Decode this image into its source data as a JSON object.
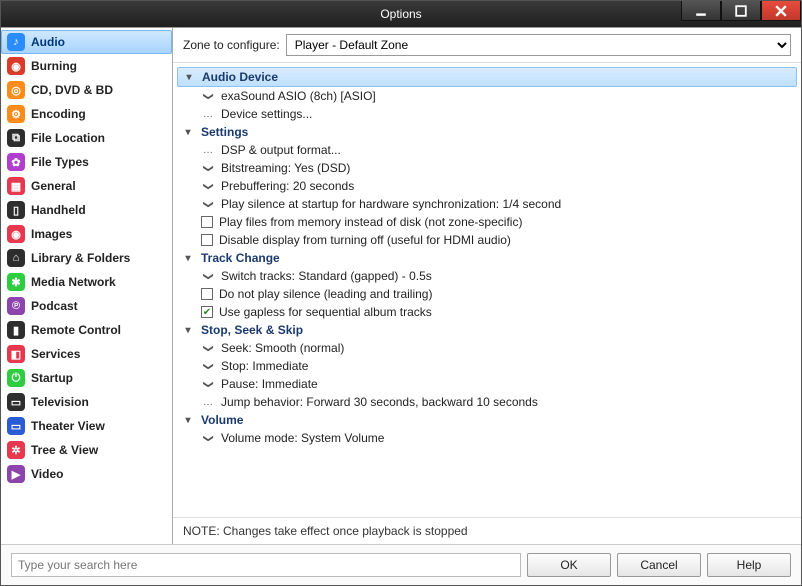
{
  "window": {
    "title": "Options"
  },
  "sidebar": {
    "items": [
      {
        "label": "Audio",
        "icon_bg": "#2a8cff",
        "glyph": "♪",
        "selected": true,
        "icon_name": "audio-icon"
      },
      {
        "label": "Burning",
        "icon_bg": "#d83b2a",
        "glyph": "◉",
        "selected": false,
        "icon_name": "burning-icon"
      },
      {
        "label": "CD, DVD & BD",
        "icon_bg": "#ff8c1a",
        "glyph": "◎",
        "selected": false,
        "icon_name": "disc-icon"
      },
      {
        "label": "Encoding",
        "icon_bg": "#ff8c1a",
        "glyph": "⚙",
        "selected": false,
        "icon_name": "encoding-icon"
      },
      {
        "label": "File Location",
        "icon_bg": "#2e2e2e",
        "glyph": "⧉",
        "selected": false,
        "icon_name": "file-location-icon"
      },
      {
        "label": "File Types",
        "icon_bg": "#b23ecf",
        "glyph": "✿",
        "selected": false,
        "icon_name": "file-types-icon"
      },
      {
        "label": "General",
        "icon_bg": "#e63950",
        "glyph": "▦",
        "selected": false,
        "icon_name": "general-icon"
      },
      {
        "label": "Handheld",
        "icon_bg": "#2e2e2e",
        "glyph": "▯",
        "selected": false,
        "icon_name": "handheld-icon"
      },
      {
        "label": "Images",
        "icon_bg": "#e63950",
        "glyph": "◉",
        "selected": false,
        "icon_name": "images-icon"
      },
      {
        "label": "Library & Folders",
        "icon_bg": "#2e2e2e",
        "glyph": "⌂",
        "selected": false,
        "icon_name": "library-icon"
      },
      {
        "label": "Media Network",
        "icon_bg": "#2ecc40",
        "glyph": "✱",
        "selected": false,
        "icon_name": "media-network-icon"
      },
      {
        "label": "Podcast",
        "icon_bg": "#8e44ad",
        "glyph": "℗",
        "selected": false,
        "icon_name": "podcast-icon"
      },
      {
        "label": "Remote Control",
        "icon_bg": "#2e2e2e",
        "glyph": "▮",
        "selected": false,
        "icon_name": "remote-icon"
      },
      {
        "label": "Services",
        "icon_bg": "#e63950",
        "glyph": "◧",
        "selected": false,
        "icon_name": "services-icon"
      },
      {
        "label": "Startup",
        "icon_bg": "#2ecc40",
        "glyph": "⏻",
        "selected": false,
        "icon_name": "startup-icon"
      },
      {
        "label": "Television",
        "icon_bg": "#2e2e2e",
        "glyph": "▭",
        "selected": false,
        "icon_name": "television-icon"
      },
      {
        "label": "Theater View",
        "icon_bg": "#2b5bd7",
        "glyph": "▭",
        "selected": false,
        "icon_name": "theater-icon"
      },
      {
        "label": "Tree & View",
        "icon_bg": "#e63950",
        "glyph": "✲",
        "selected": false,
        "icon_name": "tree-view-icon"
      },
      {
        "label": "Video",
        "icon_bg": "#8e44ad",
        "glyph": "▶",
        "selected": false,
        "icon_name": "video-icon"
      }
    ]
  },
  "zone": {
    "label": "Zone to configure:",
    "value": "Player - Default Zone"
  },
  "sections": [
    {
      "title": "Audio Device",
      "highlighted": true,
      "items": [
        {
          "kind": "expand",
          "text": "exaSound ASIO (8ch) [ASIO]"
        },
        {
          "kind": "more",
          "text": "Device settings..."
        }
      ]
    },
    {
      "title": "Settings",
      "highlighted": false,
      "items": [
        {
          "kind": "more",
          "text": "DSP & output format..."
        },
        {
          "kind": "expand",
          "text": "Bitstreaming: Yes (DSD)"
        },
        {
          "kind": "expand",
          "text": "Prebuffering: 20 seconds"
        },
        {
          "kind": "expand",
          "text": "Play silence at startup for hardware synchronization: 1/4 second"
        },
        {
          "kind": "check",
          "checked": false,
          "text": "Play files from memory instead of disk (not zone-specific)"
        },
        {
          "kind": "check",
          "checked": false,
          "text": "Disable display from turning off (useful for HDMI audio)"
        }
      ]
    },
    {
      "title": "Track Change",
      "highlighted": false,
      "items": [
        {
          "kind": "expand",
          "text": "Switch tracks: Standard (gapped) - 0.5s"
        },
        {
          "kind": "check",
          "checked": false,
          "text": "Do not play silence (leading and trailing)"
        },
        {
          "kind": "check",
          "checked": true,
          "text": "Use gapless for sequential album tracks"
        }
      ]
    },
    {
      "title": "Stop, Seek & Skip",
      "highlighted": false,
      "items": [
        {
          "kind": "expand",
          "text": "Seek: Smooth (normal)"
        },
        {
          "kind": "expand",
          "text": "Stop: Immediate"
        },
        {
          "kind": "expand",
          "text": "Pause: Immediate"
        },
        {
          "kind": "more",
          "text": "Jump behavior: Forward 30 seconds, backward 10 seconds"
        }
      ]
    },
    {
      "title": "Volume",
      "highlighted": false,
      "items": [
        {
          "kind": "expand",
          "text": "Volume mode: System Volume"
        }
      ]
    }
  ],
  "note": "NOTE: Changes take effect once playback is stopped",
  "footer": {
    "search_placeholder": "Type your search here",
    "ok": "OK",
    "cancel": "Cancel",
    "help": "Help"
  }
}
